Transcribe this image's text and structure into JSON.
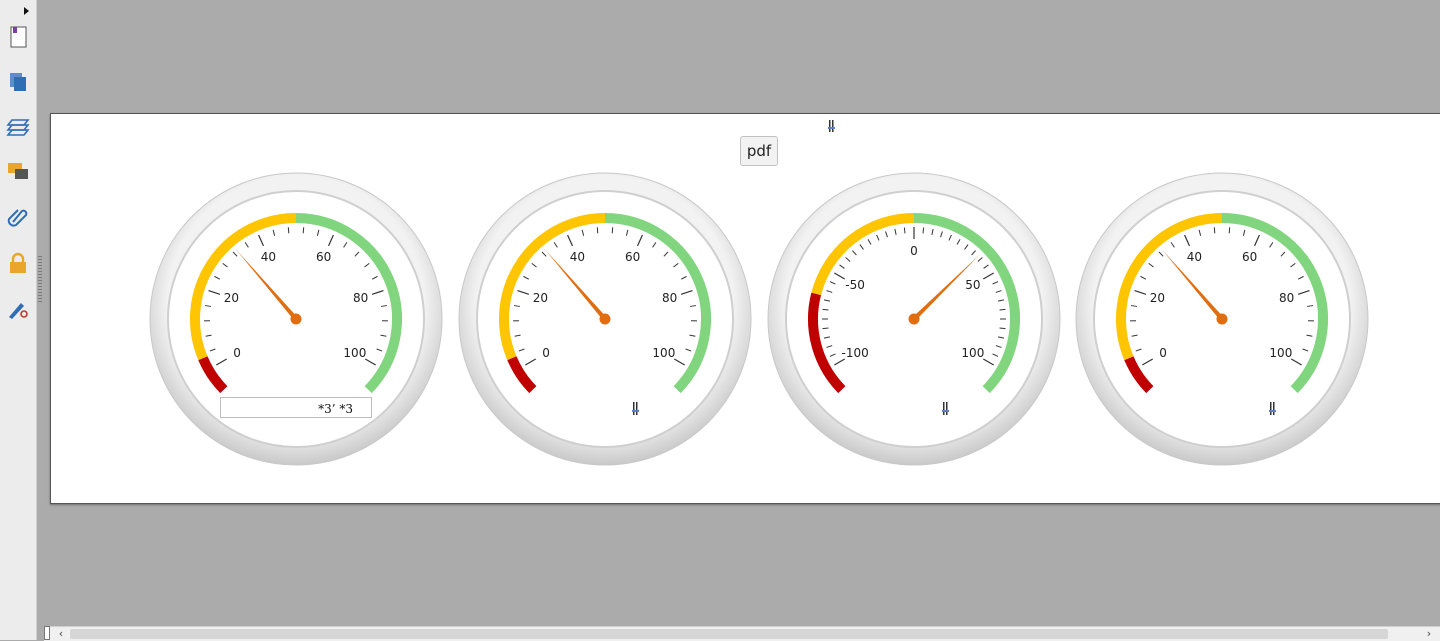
{
  "toolbar": {
    "icons": [
      "toggle-arrow-icon",
      "page-thumbnail-icon",
      "copy-pages-icon",
      "layers-icon",
      "comments-icon",
      "attachment-icon",
      "lock-icon",
      "signature-icon"
    ]
  },
  "page": {
    "pdf_button_label": "pdf",
    "text_field_value": "*3’ *3"
  },
  "gauges": [
    {
      "labels": [
        "0",
        "20",
        "40",
        "60",
        "80",
        "100"
      ],
      "min": 0,
      "max": 100,
      "value": 33,
      "major_count": 6,
      "minor_per": 5,
      "bands": [
        {
          "from": -6,
          "to": 3,
          "color": "#c00000"
        },
        {
          "from": 3,
          "to": 50,
          "color": "#ffc500"
        },
        {
          "from": 50,
          "to": 106,
          "color": "#80d57e"
        }
      ]
    },
    {
      "labels": [
        "0",
        "20",
        "40",
        "60",
        "80",
        "100"
      ],
      "min": 0,
      "max": 100,
      "value": 33,
      "major_count": 6,
      "minor_per": 5,
      "bands": [
        {
          "from": -6,
          "to": 3,
          "color": "#c00000"
        },
        {
          "from": 3,
          "to": 50,
          "color": "#ffc500"
        },
        {
          "from": 50,
          "to": 106,
          "color": "#80d57e"
        }
      ]
    },
    {
      "labels": [
        "-100",
        "-50",
        "0",
        "50",
        "100"
      ],
      "min": -100,
      "max": 100,
      "value": 38,
      "major_count": 5,
      "minor_per": 10,
      "bands": [
        {
          "from": -112,
          "to": -63,
          "color": "#c00000"
        },
        {
          "from": -63,
          "to": 0,
          "color": "#ffc500"
        },
        {
          "from": 0,
          "to": 112,
          "color": "#80d57e"
        }
      ]
    },
    {
      "labels": [
        "0",
        "20",
        "40",
        "60",
        "80",
        "100"
      ],
      "min": 0,
      "max": 100,
      "value": 33,
      "major_count": 6,
      "minor_per": 5,
      "bands": [
        {
          "from": -6,
          "to": 3,
          "color": "#c00000"
        },
        {
          "from": 3,
          "to": 50,
          "color": "#ffc500"
        },
        {
          "from": 50,
          "to": 106,
          "color": "#80d57e"
        }
      ]
    }
  ],
  "colors": {
    "needle": "#e06e10",
    "bezel": "#dcdcdc",
    "background": "#ababab"
  }
}
